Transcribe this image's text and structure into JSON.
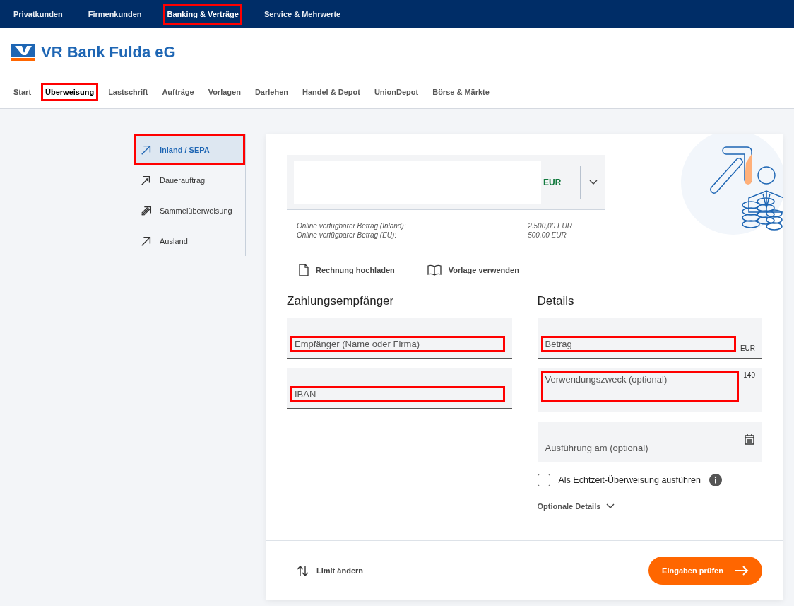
{
  "top_nav": [
    {
      "label": "Privatkunden",
      "selected": false,
      "highlighted": false
    },
    {
      "label": "Firmenkunden",
      "selected": false,
      "highlighted": false
    },
    {
      "label": "Banking & Verträge",
      "selected": true,
      "highlighted": true
    },
    {
      "label": "Service & Mehrwerte",
      "selected": false,
      "highlighted": false
    }
  ],
  "logo": {
    "text": "VR Bank Fulda eG"
  },
  "tabs": [
    {
      "label": "Start",
      "selected": false,
      "highlighted": false
    },
    {
      "label": "Überweisung",
      "selected": true,
      "highlighted": true
    },
    {
      "label": "Lastschrift",
      "selected": false,
      "highlighted": false
    },
    {
      "label": "Aufträge",
      "selected": false,
      "highlighted": false
    },
    {
      "label": "Vorlagen",
      "selected": false,
      "highlighted": false
    },
    {
      "label": "Darlehen",
      "selected": false,
      "highlighted": false
    },
    {
      "label": "Handel & Depot",
      "selected": false,
      "highlighted": false
    },
    {
      "label": "UnionDepot",
      "selected": false,
      "highlighted": false
    },
    {
      "label": "Börse & Märkte",
      "selected": false,
      "highlighted": false
    }
  ],
  "sidebar": {
    "items": [
      {
        "label": "Inland / SEPA",
        "kind": "single",
        "selected": true,
        "highlighted": true
      },
      {
        "label": "Dauerauftrag",
        "kind": "double",
        "selected": false,
        "highlighted": false
      },
      {
        "label": "Sammelüberweisung",
        "kind": "multi",
        "selected": false,
        "highlighted": false
      },
      {
        "label": "Ausland",
        "kind": "single",
        "selected": false,
        "highlighted": false
      }
    ]
  },
  "account": {
    "currency": "EUR",
    "balances": [
      {
        "label": "Online verfügbarer Betrag (Inland):",
        "value": "2.500,00 EUR"
      },
      {
        "label": "Online verfügbarer Betrag (EU):",
        "value": "500,00 EUR"
      }
    ]
  },
  "actions": [
    {
      "label": "Rechnung hochladen",
      "kind": "document"
    },
    {
      "label": "Vorlage verwenden",
      "kind": "book"
    }
  ],
  "recipient": {
    "title": "Zahlungsempfänger",
    "fields": [
      {
        "placeholder": "Empfänger (Name oder Firma)",
        "highlighted": true
      },
      {
        "placeholder": "IBAN",
        "highlighted": true
      }
    ]
  },
  "details": {
    "title": "Details",
    "fields": [
      {
        "kind": "amount",
        "placeholder": "Betrag",
        "suffix": "EUR",
        "highlighted": true
      },
      {
        "kind": "text",
        "placeholder": "Verwendungszweck (optional)",
        "counter": "140",
        "highlighted": true
      },
      {
        "kind": "date",
        "placeholder": "Ausführung am (optional)",
        "highlighted": false
      }
    ],
    "instant": {
      "label": "Als Echtzeit-Überweisung ausführen",
      "checked": false
    },
    "optional": {
      "label": "Optionale Details",
      "expanded": false
    }
  },
  "footer": {
    "limit": "Limit ändern",
    "submit": "Eingaben prüfen"
  }
}
